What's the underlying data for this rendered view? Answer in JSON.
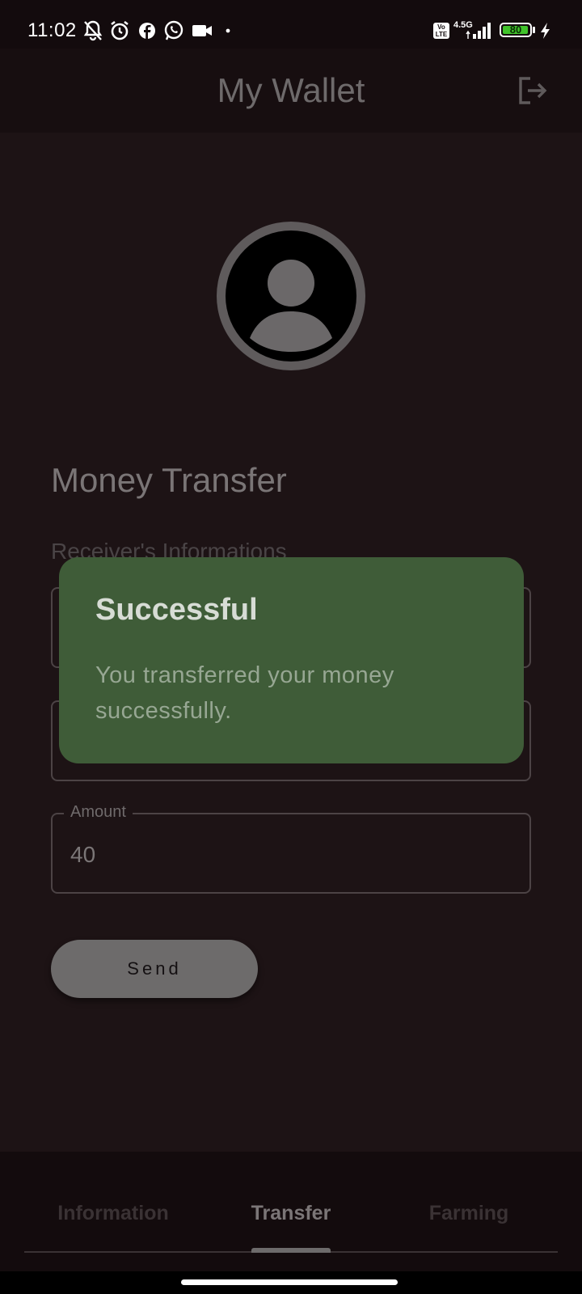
{
  "status_bar": {
    "time": "11:02",
    "network": "4.5G",
    "volte": "Vo LTE",
    "battery": "80"
  },
  "app_bar": {
    "title": "My Wallet",
    "logout_icon": "logout-icon"
  },
  "page": {
    "section_title": "Money Transfer",
    "subtitle": "Receiver's Informations"
  },
  "fields": {
    "amount": {
      "label": "Amount",
      "value": "40"
    }
  },
  "send_button": {
    "label": "Send"
  },
  "dialog": {
    "title": "Successful",
    "message": "You transferred your money successfully."
  },
  "bottom_nav": {
    "tabs": [
      {
        "label": "Information",
        "selected": false
      },
      {
        "label": "Transfer",
        "selected": true
      },
      {
        "label": "Farming",
        "selected": false
      }
    ]
  },
  "colors": {
    "background": "#1d1315",
    "dialog": "#3f5c38",
    "accent": "#6d6b6b"
  }
}
